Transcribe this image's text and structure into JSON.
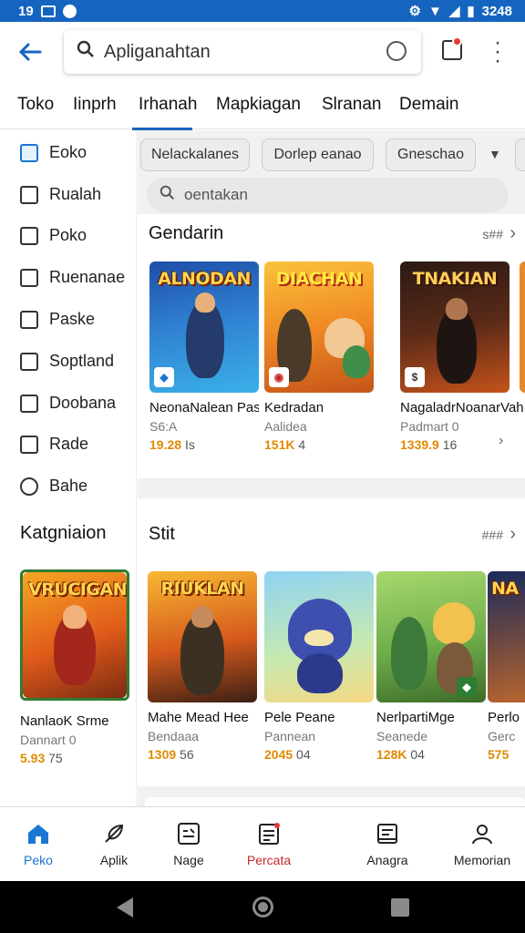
{
  "status_bar": {
    "time": "19",
    "right_time": "3248"
  },
  "top_bar": {
    "search_text": "Apliganahtan"
  },
  "tabs": [
    "Toko",
    "Iinprh",
    "Irhanah",
    "Mapkiagan",
    "Slranan",
    "Demain"
  ],
  "sidebar": {
    "items": [
      "Eoko",
      "Rualah",
      "Poko",
      "Ruenanae",
      "Paske",
      "Soptland",
      "Doobana",
      "Rade",
      "Bahe"
    ],
    "section_title": "Katgniaion",
    "card": {
      "art_title": "VRUCIGAN",
      "title": "NanlaoK Srme",
      "sub": "Dannart 0",
      "rating": "5.93",
      "meta": "75"
    }
  },
  "chips": [
    "Nelackalanes",
    "Dorlep eanao",
    "Gneschao"
  ],
  "search": {
    "placeholder": "oentakan"
  },
  "section1": {
    "title": "Gendarin",
    "more": "s##",
    "cards": [
      {
        "art_title": "ALNODAN",
        "title": "NeonaNalean Pash",
        "sub": "S6:A",
        "rating": "19.28",
        "meta": "Is",
        "art": "blue"
      },
      {
        "art_title": "DIACHAN",
        "title": "Kedradan",
        "sub": "Aalidea",
        "rating": "151K",
        "meta": "4",
        "art": "orange"
      },
      {
        "art_title": "TNAKIAN",
        "title": "NagaladrNoanarVah.",
        "sub": "Padmart 0",
        "rating": "1339.9",
        "meta": "16",
        "art": "dark"
      }
    ]
  },
  "section2": {
    "title": "Stit",
    "more": "###",
    "cards": [
      {
        "art_title": "RIUKLAN",
        "title": "Mahe Mead Hee",
        "sub": "Bendaaa",
        "rating": "1309",
        "meta": "56",
        "art": "gold"
      },
      {
        "art_title": "",
        "title": "Pele Peane",
        "sub": "Pannean",
        "rating": "2045",
        "meta": "04",
        "art": "sky"
      },
      {
        "art_title": "",
        "title": "NerlpartiMge",
        "sub": "Seanede",
        "rating": "128K",
        "meta": "04",
        "art": "green"
      },
      {
        "art_title": "NA",
        "title": "Perlo",
        "sub": "Gerc",
        "rating": "575",
        "meta": "",
        "art": "night"
      }
    ]
  },
  "bottom_nav": [
    "Peko",
    "Aplik",
    "Nage",
    "Percata",
    "Anagra",
    "Memorian"
  ],
  "colors": {
    "primary": "#1565c0",
    "accent": "#1976d2",
    "star": "#e08a00",
    "alert": "#c62828"
  }
}
